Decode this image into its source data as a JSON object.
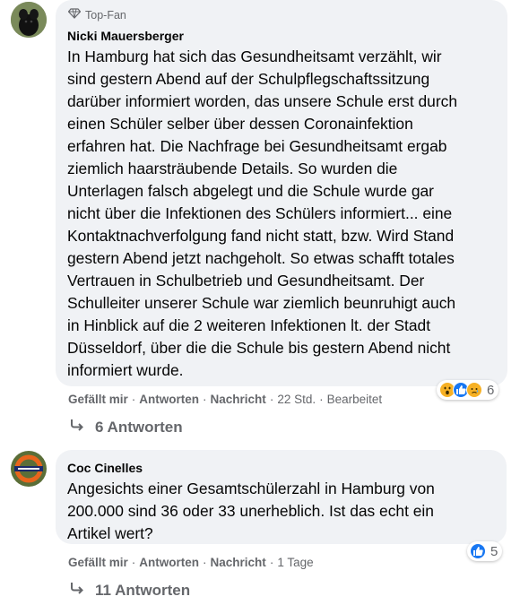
{
  "comments": [
    {
      "badge": "Top-Fan",
      "author": "Nicki Mauersberger",
      "lines": [
        "In Hamburg hat sich das Gesundheitsamt verzählt, wir",
        "sind gestern Abend auf der Schulpflegschaftssitzung",
        "darüber informiert worden, das unsere Schule erst durch",
        "einen Schüler selber über dessen Coronainfektion",
        "erfahren hat. Die Nachfrage bei Gesundheitsamt ergab",
        "ziemlich haarsträubende Details. So wurden die",
        "Unterlagen falsch abgelegt und die Schule wurde gar",
        "nicht über die Infektionen des Schülers informiert... eine",
        "Kontaktnachverfolgung fand nicht statt, bzw. Wird Stand",
        "gestern Abend jetzt nachgeholt. So etwas schafft totales",
        "Vertrauen in Schulbetrieb und Gesundheitsamt. Der",
        "Schulleiter unserer Schule war ziemlich beunruhigt auch",
        "in Hinblick auf die 2 weiteren Infektionen lt. der Stadt",
        "Düsseldorf, über die die Schule bis gestern Abend nicht",
        "informiert wurde."
      ],
      "like_label": "Gefällt mir",
      "reply_label": "Antworten",
      "message_label": "Nachricht",
      "time": "22 Std.",
      "edited": "Bearbeitet",
      "reaction_count": "6",
      "replies_label": "6 Antworten"
    },
    {
      "author": "Coc Cinelles",
      "lines": [
        "Angesichts einer Gesamtschülerzahl in Hamburg von",
        "200.000 sind 36 oder 33 unerheblich. Ist das echt ein",
        "Artikel wert?"
      ],
      "like_label": "Gefällt mir",
      "reply_label": "Antworten",
      "message_label": "Nachricht",
      "time": "1 Tage",
      "reaction_count": "5",
      "replies_label": "11 Antworten"
    }
  ],
  "colors": {
    "bubble": "#f0f2f5",
    "meta": "#65676b",
    "like_blue": "#1877f2",
    "wow_yellow": "#f7b125"
  }
}
